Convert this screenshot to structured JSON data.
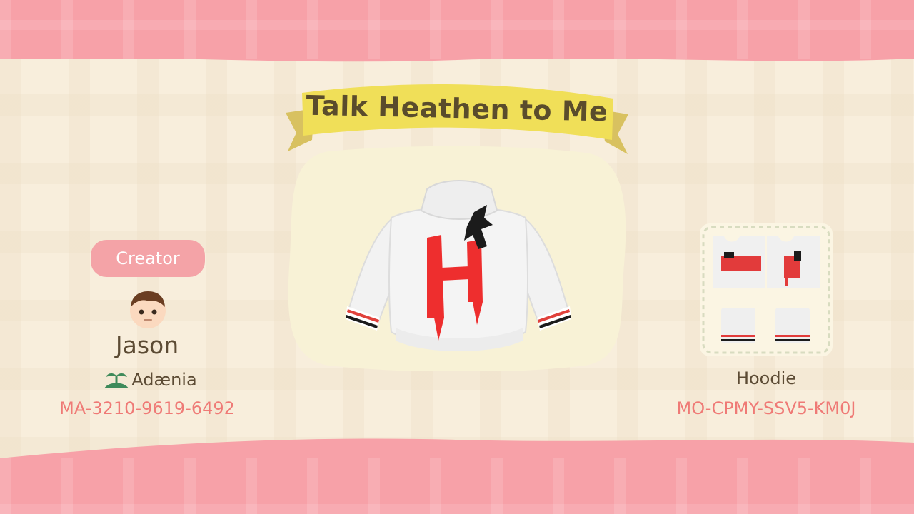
{
  "design": {
    "title": "Talk Heathen to Me",
    "item_type": "Hoodie",
    "design_code": "MO-CPMY-SSV5-KM0J",
    "colors": {
      "hoodie": "#f2f2f2",
      "print_red": "#ee2e2e",
      "print_black": "#1b1b1b",
      "stripe_red": "#e0413b"
    }
  },
  "creator": {
    "label": "Creator",
    "name": "Jason",
    "island": "Adænia",
    "island_icon": "island-palm-icon",
    "code": "MA-3210-9619-6492"
  },
  "theme": {
    "band_color": "#f7a1a8",
    "panel_color": "#f8eedc",
    "banner_color": "#f0df58",
    "accent_text": "#ef7a76",
    "body_text": "#5c4b34"
  }
}
